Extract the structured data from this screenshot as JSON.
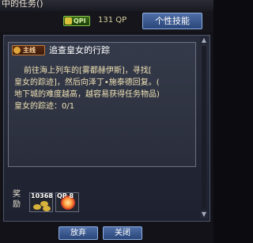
{
  "window": {
    "title": "中的任务()"
  },
  "topbar": {
    "qp_badge_label": "QPI",
    "qp_amount": "131 QP",
    "personality_skill_button": "个性技能"
  },
  "quest": {
    "tag": "主线",
    "title": "追查皇女的行踪",
    "description_lines": [
      "前往海上列车的[雾都赫伊斯]，寻找[",
      "皇女的踪迹]，然后向泽丁•施泰德回复。(",
      "地下城的难度越高，越容易获得任务物品)",
      "皇女的踪迹：0/1"
    ]
  },
  "rewards": {
    "label": "奖励",
    "items": [
      {
        "icon": "gold-coins-icon",
        "count": "10368"
      },
      {
        "icon": "qp-reward-icon",
        "count": "QP 8"
      }
    ]
  },
  "footer": {
    "abandon_button": "放弃",
    "close_button": "关闭"
  },
  "colors": {
    "panel_bg": "#2a2e3c",
    "button_blue": "#4f6ea6",
    "text_parchment": "#efe1b4",
    "tag_orange": "#c07a3a"
  }
}
